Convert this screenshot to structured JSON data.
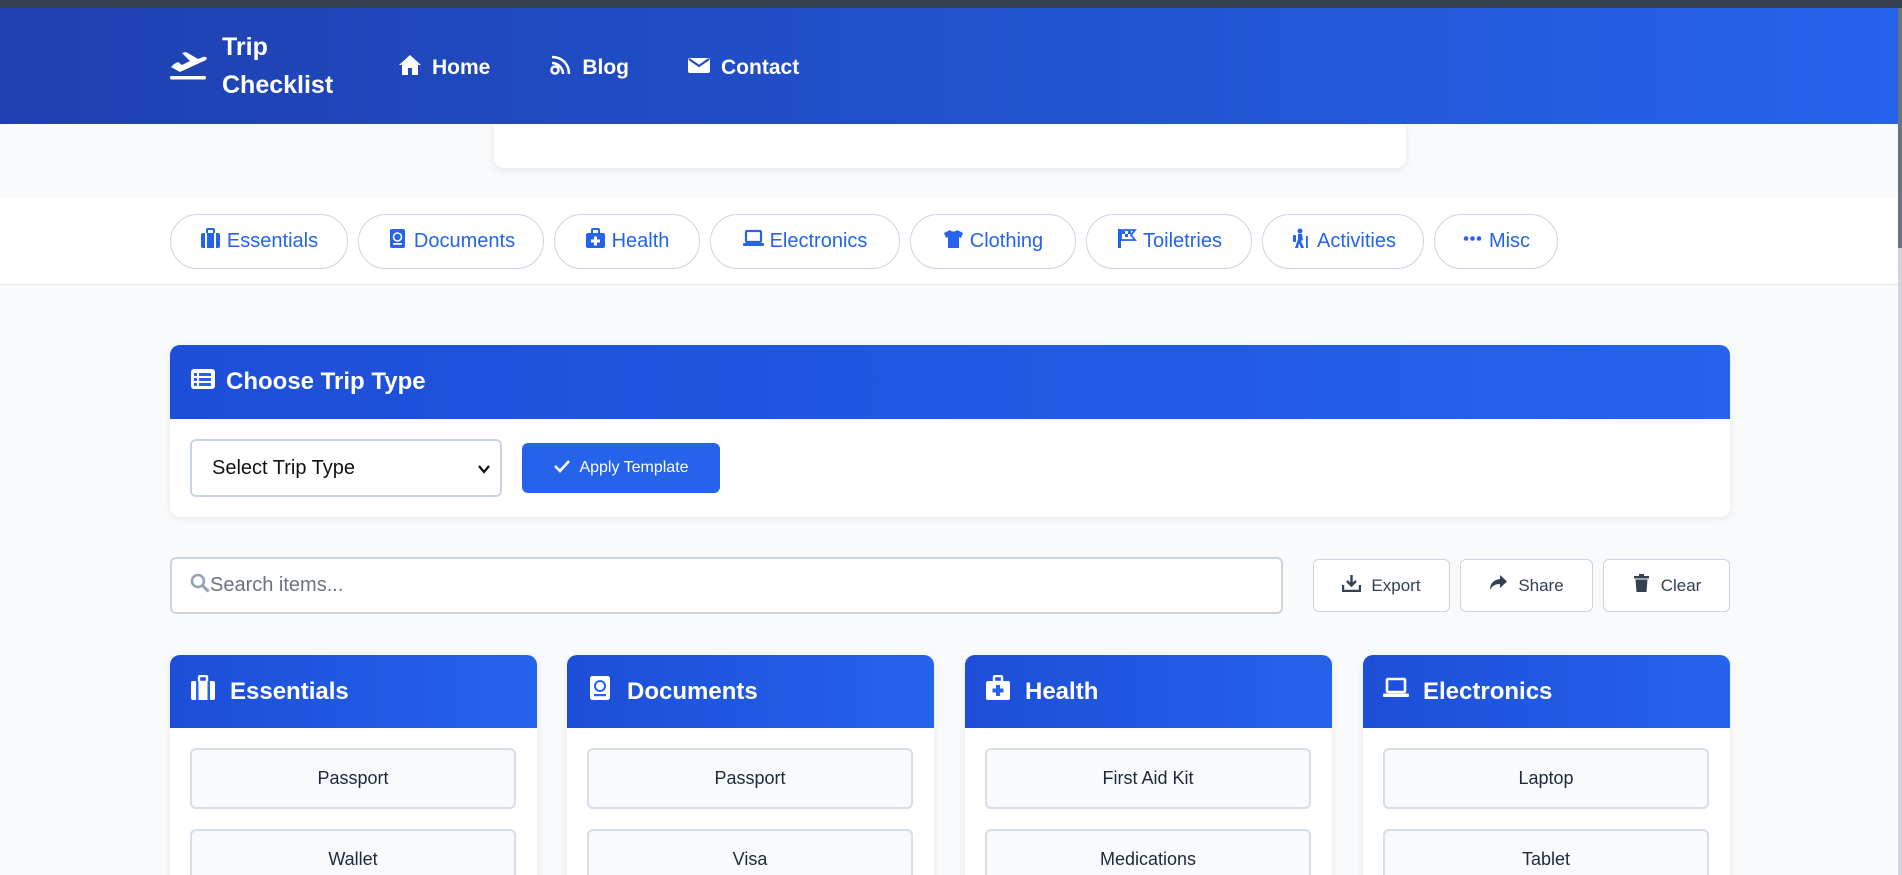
{
  "app": {
    "brand": "Trip Checklist"
  },
  "nav": {
    "home": "Home",
    "blog": "Blog",
    "contact": "Contact"
  },
  "categories_bar": [
    "Essentials",
    "Documents",
    "Health",
    "Electronics",
    "Clothing",
    "Toiletries",
    "Activities",
    "Misc"
  ],
  "trip_type": {
    "title": "Choose Trip Type",
    "select_value": "Select Trip Type",
    "apply_label": "Apply Template"
  },
  "search": {
    "placeholder": "Search items..."
  },
  "actions": {
    "export": "Export",
    "share": "Share",
    "clear": "Clear"
  },
  "cards": [
    {
      "title": "Essentials",
      "items": [
        "Passport",
        "Wallet"
      ]
    },
    {
      "title": "Documents",
      "items": [
        "Passport",
        "Visa"
      ]
    },
    {
      "title": "Health",
      "items": [
        "First Aid Kit",
        "Medications"
      ]
    },
    {
      "title": "Electronics",
      "items": [
        "Laptop",
        "Tablet"
      ]
    }
  ],
  "colors": {
    "primary": "#2563eb",
    "primary_dark": "#1e40af"
  }
}
